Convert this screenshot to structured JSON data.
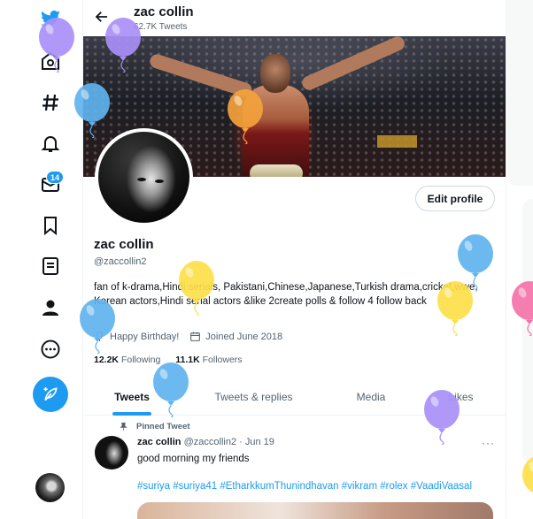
{
  "colors": {
    "accent": "#1d9bf0",
    "text": "#0f1419",
    "muted": "#536471",
    "border": "#cfd9de"
  },
  "nav": {
    "icons": [
      "twitter-logo-icon",
      "home-icon",
      "explore-hashtag-icon",
      "notifications-bell-icon",
      "messages-icon",
      "bookmarks-icon",
      "lists-icon",
      "profile-icon",
      "more-icon",
      "compose-tweet-icon"
    ],
    "messages_badge": "14"
  },
  "header": {
    "name": "zac collin",
    "tweet_count": "62.7K Tweets"
  },
  "profile": {
    "edit_label": "Edit profile",
    "name": "zac collin",
    "handle": "@zaccollin2",
    "bio": "fan of k-drama,Hindi serials, Pakistani,Chinese,Japanese,Turkish drama,cricket,wwe, Korean actors,Hindi serial actors &like 2create polls & follow 4 follow back",
    "birthday": "Happy Birthday!",
    "joined": "Joined June 2018",
    "following_count": "12.2K",
    "following_label": "Following",
    "followers_count": "11.1K",
    "followers_label": "Followers"
  },
  "tabs": [
    {
      "label": "Tweets",
      "active": true
    },
    {
      "label": "Tweets & replies",
      "active": false
    },
    {
      "label": "Media",
      "active": false
    },
    {
      "label": "Likes",
      "active": false
    }
  ],
  "pinned_tweet": {
    "pinned_label": "Pinned Tweet",
    "author_name": "zac collin",
    "author_handle": "@zaccollin2",
    "separator": "·",
    "date": "Jun 19",
    "more": "···",
    "text": "good morning my friends",
    "hashtags": "#suriya #suriya41 #EtharkkumThunindhavan #vikram #rolex #VaadiVaasal"
  },
  "balloons": [
    {
      "color": "#a88ff7"
    },
    {
      "color": "#a88ff7"
    },
    {
      "color": "#5fb3ef"
    },
    {
      "color": "#f4a23c"
    },
    {
      "color": "#fde04a"
    },
    {
      "color": "#5fb3ef"
    },
    {
      "color": "#5fb3ef"
    },
    {
      "color": "#fde04a"
    },
    {
      "color": "#f472a8"
    },
    {
      "color": "#5fb3ef"
    },
    {
      "color": "#a88ff7"
    },
    {
      "color": "#fde04a"
    }
  ]
}
